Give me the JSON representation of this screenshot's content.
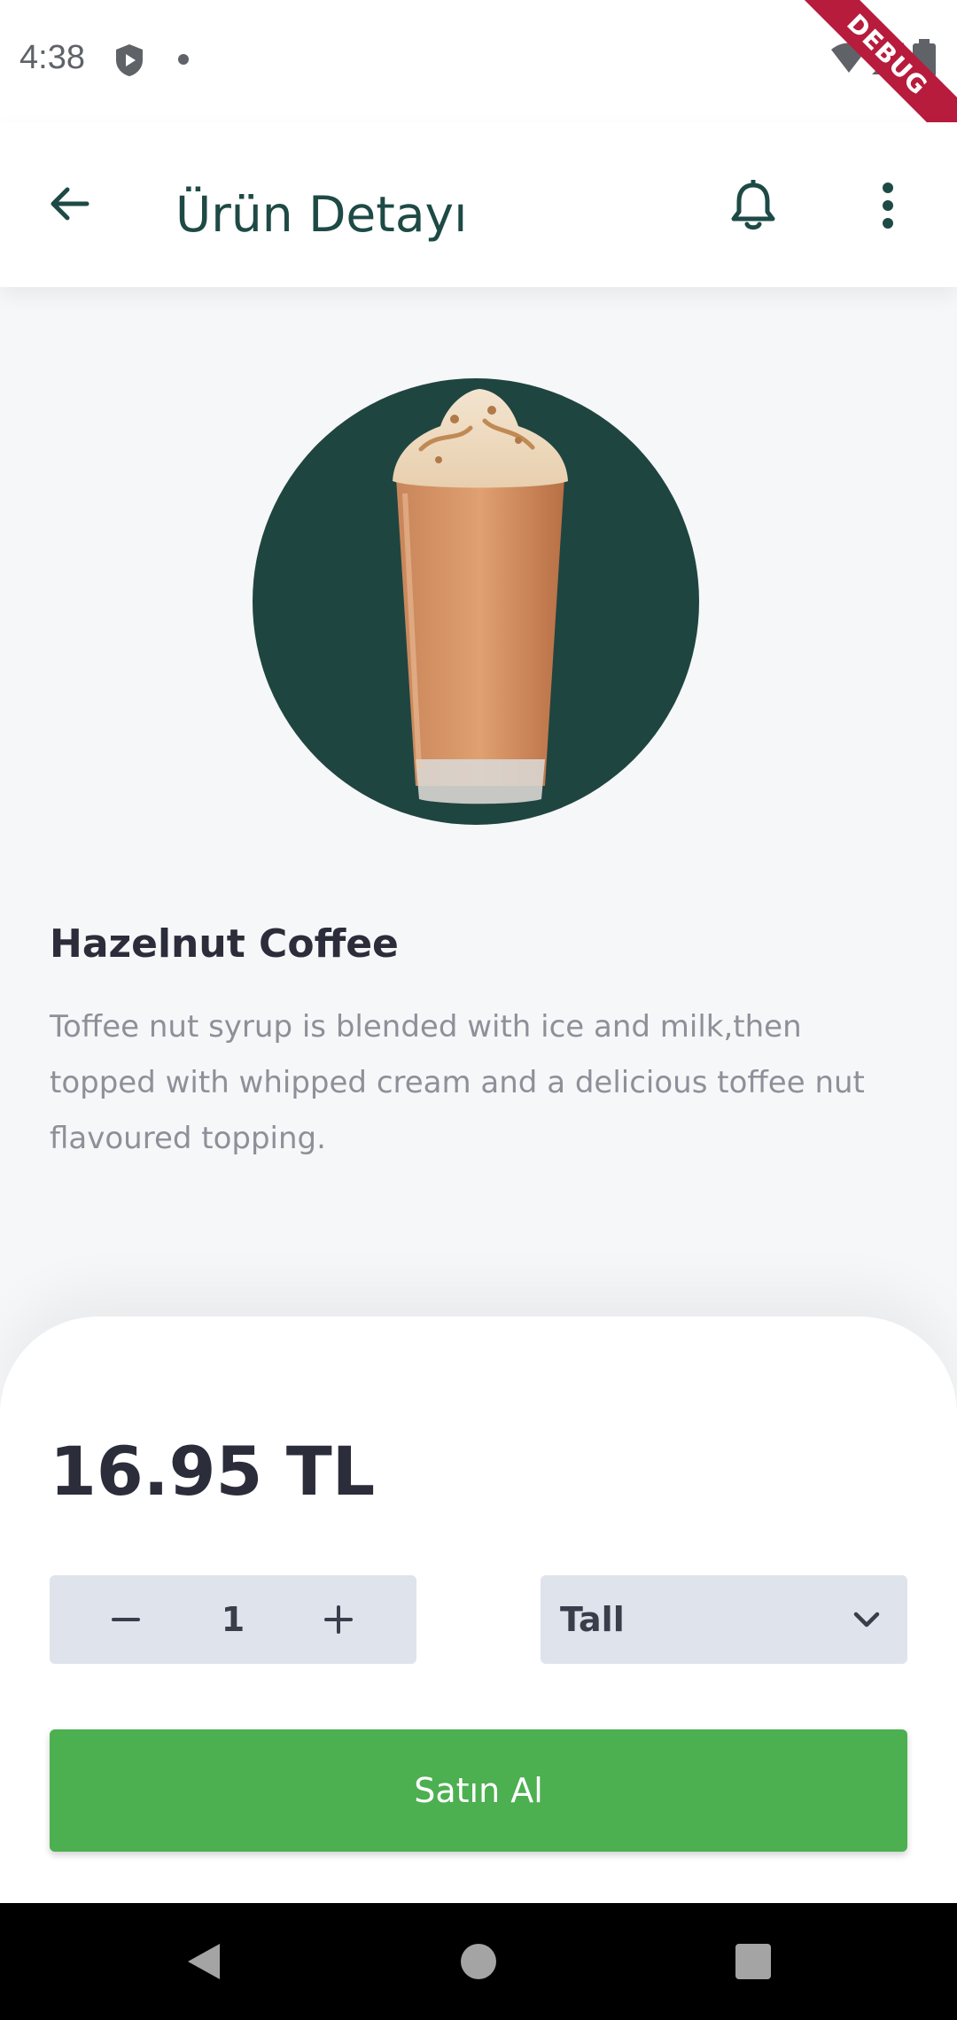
{
  "status_bar": {
    "time": "4:38",
    "icons": [
      "shield-icon",
      "dot-icon",
      "wifi-icon",
      "signal-icon",
      "battery-icon"
    ]
  },
  "debug_banner": "DEBUG",
  "app_bar": {
    "title": "Ürün Detayı",
    "back_icon": "arrow-left-icon",
    "bell_icon": "bell-icon",
    "menu_icon": "more-vert-icon"
  },
  "product": {
    "name": "Hazelnut Coffee",
    "description": "Toffee nut syrup is blended with ice and milk,then topped with whipped cream and a delicious toffee nut flavoured topping.",
    "price": "16.95 TL"
  },
  "order": {
    "quantity": "1",
    "size": "Tall",
    "buy_label": "Satın Al"
  },
  "colors": {
    "accent": "#1e4a45",
    "buy_button": "#4caf50",
    "image_bg": "#1f4540"
  },
  "nav_bar": {
    "icons": [
      "back-triangle-icon",
      "home-circle-icon",
      "recents-square-icon"
    ]
  }
}
